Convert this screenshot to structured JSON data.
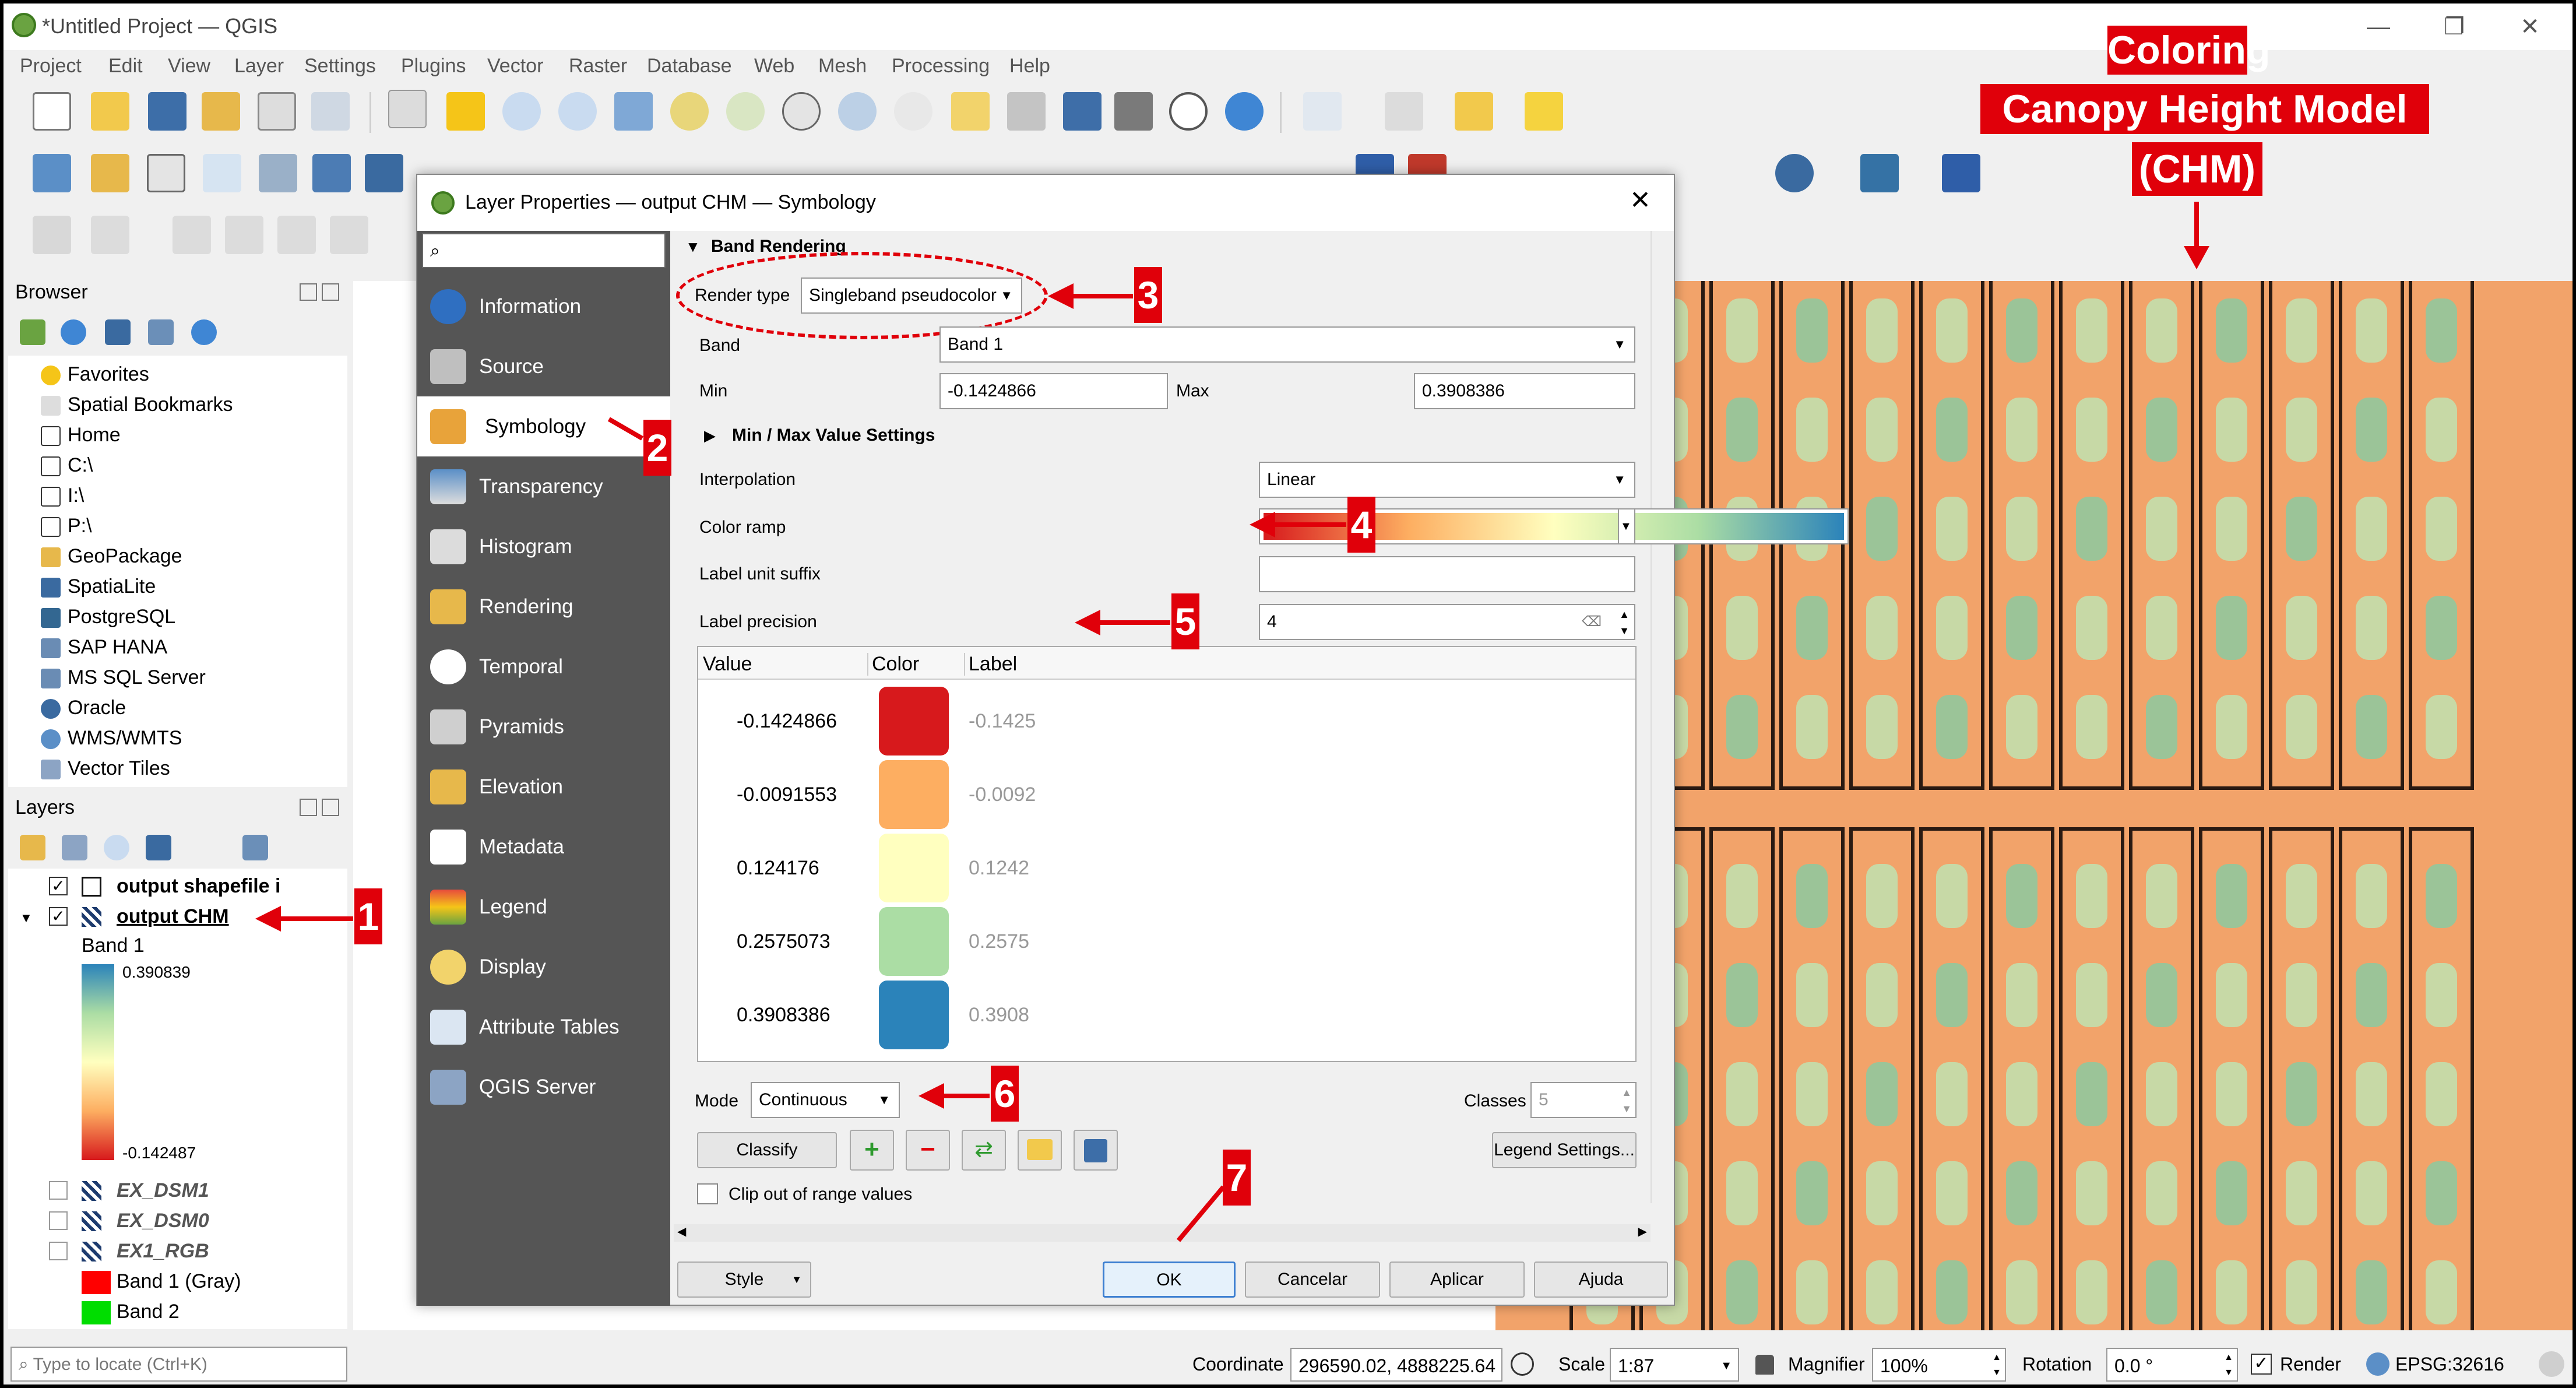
{
  "window": {
    "title": "*Untitled Project — QGIS"
  },
  "menu": [
    "Project",
    "Edit",
    "View",
    "Layer",
    "Settings",
    "Plugins",
    "Vector",
    "Raster",
    "Database",
    "Web",
    "Mesh",
    "Processing",
    "Help"
  ],
  "annotation": {
    "line1": "Coloring",
    "line2": "Canopy Height Model",
    "line3": "(CHM)"
  },
  "steps": {
    "s1": "1",
    "s2": "2",
    "s3": "3",
    "s4": "4",
    "s5": "5",
    "s6": "6",
    "s7": "7"
  },
  "browser": {
    "title": "Browser",
    "items": [
      "Favorites",
      "Spatial Bookmarks",
      "Home",
      "C:\\",
      "I:\\",
      "P:\\",
      "GeoPackage",
      "SpatiaLite",
      "PostgreSQL",
      "SAP HANA",
      "MS SQL Server",
      "Oracle",
      "WMS/WMTS",
      "Vector Tiles"
    ]
  },
  "layers": {
    "title": "Layers",
    "shapefile": "output shapefile i",
    "chm": "output CHM",
    "band": "Band 1",
    "max": "0.390839",
    "min": "-0.142487",
    "dsm1": "EX_DSM1",
    "dsm0": "EX_DSM0",
    "rgb": "EX1_RGB",
    "band_gray": "Band 1 (Gray)",
    "band2": "Band 2"
  },
  "locate": {
    "placeholder": "Type to locate (Ctrl+K)"
  },
  "dialog": {
    "title": "Layer Properties — output CHM — Symbology",
    "sidebar": [
      "Information",
      "Source",
      "Symbology",
      "Transparency",
      "Histogram",
      "Rendering",
      "Temporal",
      "Pyramids",
      "Elevation",
      "Metadata",
      "Legend",
      "Display",
      "Attribute Tables",
      "QGIS Server"
    ],
    "section": "Band Rendering",
    "render_type_label": "Render type",
    "render_type": "Singleband pseudocolor",
    "band_label": "Band",
    "band": "Band 1",
    "min_label": "Min",
    "min": "-0.1424866",
    "max_label": "Max",
    "max": "0.3908386",
    "minmax_settings": "Min / Max Value Settings",
    "interp_label": "Interpolation",
    "interp": "Linear",
    "ramp_label": "Color ramp",
    "suffix_label": "Label unit suffix",
    "precision_label": "Label precision",
    "precision": "4",
    "table_headers": [
      "Value",
      "Color",
      "Label"
    ],
    "rows": [
      {
        "value": "-0.1424866",
        "label": "-0.1425",
        "color": "#d7191c"
      },
      {
        "value": "-0.0091553",
        "label": "-0.0092",
        "color": "#fdae61"
      },
      {
        "value": "0.124176",
        "label": "0.1242",
        "color": "#ffffbf"
      },
      {
        "value": "0.2575073",
        "label": "0.2575",
        "color": "#abdda4"
      },
      {
        "value": "0.3908386",
        "label": "0.3908",
        "color": "#2b83ba"
      }
    ],
    "mode_label": "Mode",
    "mode": "Continuous",
    "classes_label": "Classes",
    "classes": "5",
    "classify": "Classify",
    "legend_settings": "Legend Settings...",
    "clip_label": "Clip out of range values",
    "style": "Style",
    "ok": "OK",
    "cancel": "Cancelar",
    "apply": "Aplicar",
    "help": "Ajuda"
  },
  "status": {
    "coordinate_label": "Coordinate",
    "coordinate": "296590.02, 4888225.64",
    "scale_label": "Scale",
    "scale": "1:87",
    "magnifier_label": "Magnifier",
    "magnifier": "100%",
    "rotation_label": "Rotation",
    "rotation": "0.0 °",
    "render_label": "Render",
    "crs": "EPSG:32616"
  }
}
